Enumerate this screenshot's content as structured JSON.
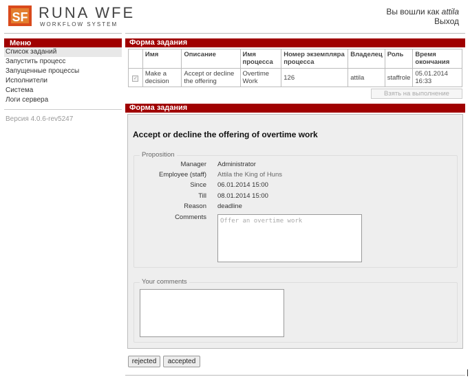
{
  "header": {
    "brand": "RUNA WFE",
    "brand_sub": "WORKFLOW SYSTEM",
    "logo_mark": "SF",
    "logged_in_prefix": "Вы вошли как ",
    "user": "attila",
    "logout": "Выход"
  },
  "sidebar": {
    "title": "Меню",
    "items": [
      {
        "label": "Список заданий"
      },
      {
        "label": "Запустить процесс"
      },
      {
        "label": "Запущенные процессы"
      },
      {
        "label": "Исполнители"
      },
      {
        "label": "Система"
      },
      {
        "label": "Логи сервера"
      }
    ],
    "version": "Версия 4.0.6-rev5247"
  },
  "task_section": {
    "title": "Форма задания",
    "columns": [
      "Имя",
      "Описание",
      "Имя процесса",
      "Номер экземпляра процесса",
      "Владелец",
      "Роль",
      "Время окончания"
    ],
    "row": {
      "name": "Make a decision",
      "description": "Accept or decline the offering",
      "process": "Overtime Work",
      "instance": "126",
      "owner": "attila",
      "role": "staffrole",
      "deadline": "05.01.2014 16:33"
    },
    "take_button": "Взять на выполнение"
  },
  "form_section": {
    "title": "Форма задания",
    "heading": "Accept or decline the offering of overtime work",
    "proposition": {
      "legend": "Proposition",
      "fields": [
        {
          "label": "Manager",
          "value": "Administrator"
        },
        {
          "label": "Employee (staff)",
          "value": "Attila the King of Huns"
        },
        {
          "label": "Since",
          "value": "06.01.2014 15:00"
        },
        {
          "label": "Till",
          "value": "08.01.2014 15:00"
        },
        {
          "label": "Reason",
          "value": "deadline"
        }
      ],
      "comments_label": "Comments",
      "comments_value": "Offer an overtime work"
    },
    "your_comments": {
      "legend": "Your comments",
      "value": ""
    }
  },
  "actions": {
    "rejected": "rejected",
    "accepted": "accepted"
  },
  "colors": {
    "accent": "#a00000"
  }
}
